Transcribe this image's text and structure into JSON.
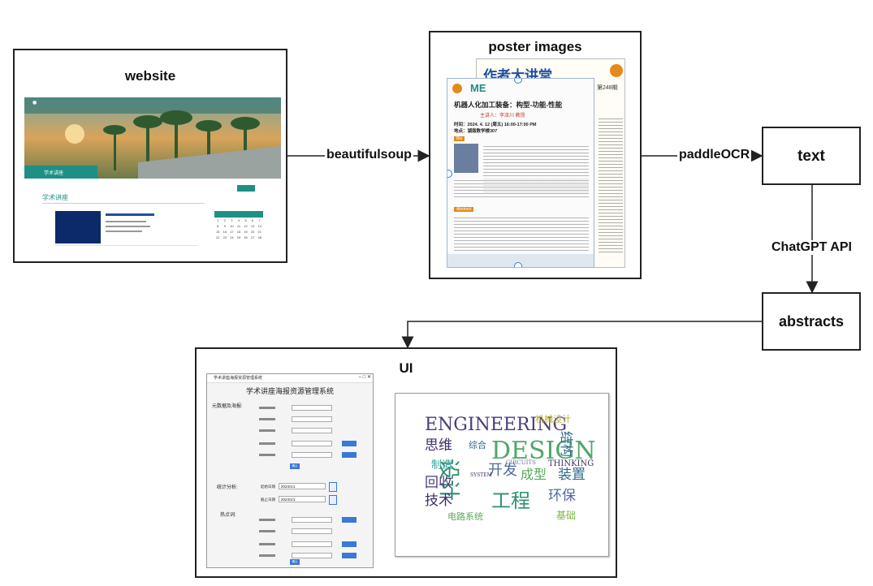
{
  "nodes": {
    "website": "website",
    "poster_images": "poster images",
    "text": "text",
    "abstracts": "abstracts",
    "ui": "UI"
  },
  "edges": {
    "beautifulsoup": "beautifulsoup",
    "paddleocr": "paddleOCR",
    "chatgpt_api": "ChatGPT API"
  },
  "website_thumb": {
    "banner_title": "学术讲座",
    "section_title": "学术讲座",
    "calendar_days": [
      "1",
      "2",
      "3",
      "4",
      "5",
      "6",
      "7",
      "8",
      "9",
      "10",
      "11",
      "12",
      "13",
      "14",
      "15",
      "16",
      "17",
      "18",
      "19",
      "20",
      "21",
      "22",
      "23",
      "24",
      "25",
      "26",
      "27",
      "28"
    ]
  },
  "poster_thumb": {
    "header": "作者大讲堂",
    "issue": "第248期",
    "title": "机器人化加工装备：构型-功能-性能",
    "speaker": "主讲人：李泽川 教授",
    "time": "时间：2024. 4. 12 (周五) 16:00-17:00 PM",
    "place": "地点：湖南数学楼307",
    "bio_tag": "Bio",
    "abstract_tag": "Abstract"
  },
  "ui_window": {
    "window_title": "学术讲座海报资源管理系统",
    "app_title": "学术讲座海报资源管理系统",
    "group_meta": "元数据及海报:",
    "group_stats": "统计分析:",
    "group_hot": "热点词:",
    "stats_start_label": "起始日期",
    "stats_end_label": "截止日期",
    "date_start": "2024/1/1",
    "date_end": "2024/1/1",
    "submit": "确认"
  },
  "wordcloud": {
    "words": [
      "ENGINEERING",
      "机械设计",
      "DESIGN",
      "思维",
      "综合",
      "制造",
      "设计",
      "开发",
      "成型",
      "装置",
      "回收",
      "技术",
      "工程",
      "环保",
      "电路系统",
      "基础",
      "THINKING",
      "CIRCUITS",
      "SYSTEM",
      "结构"
    ]
  }
}
